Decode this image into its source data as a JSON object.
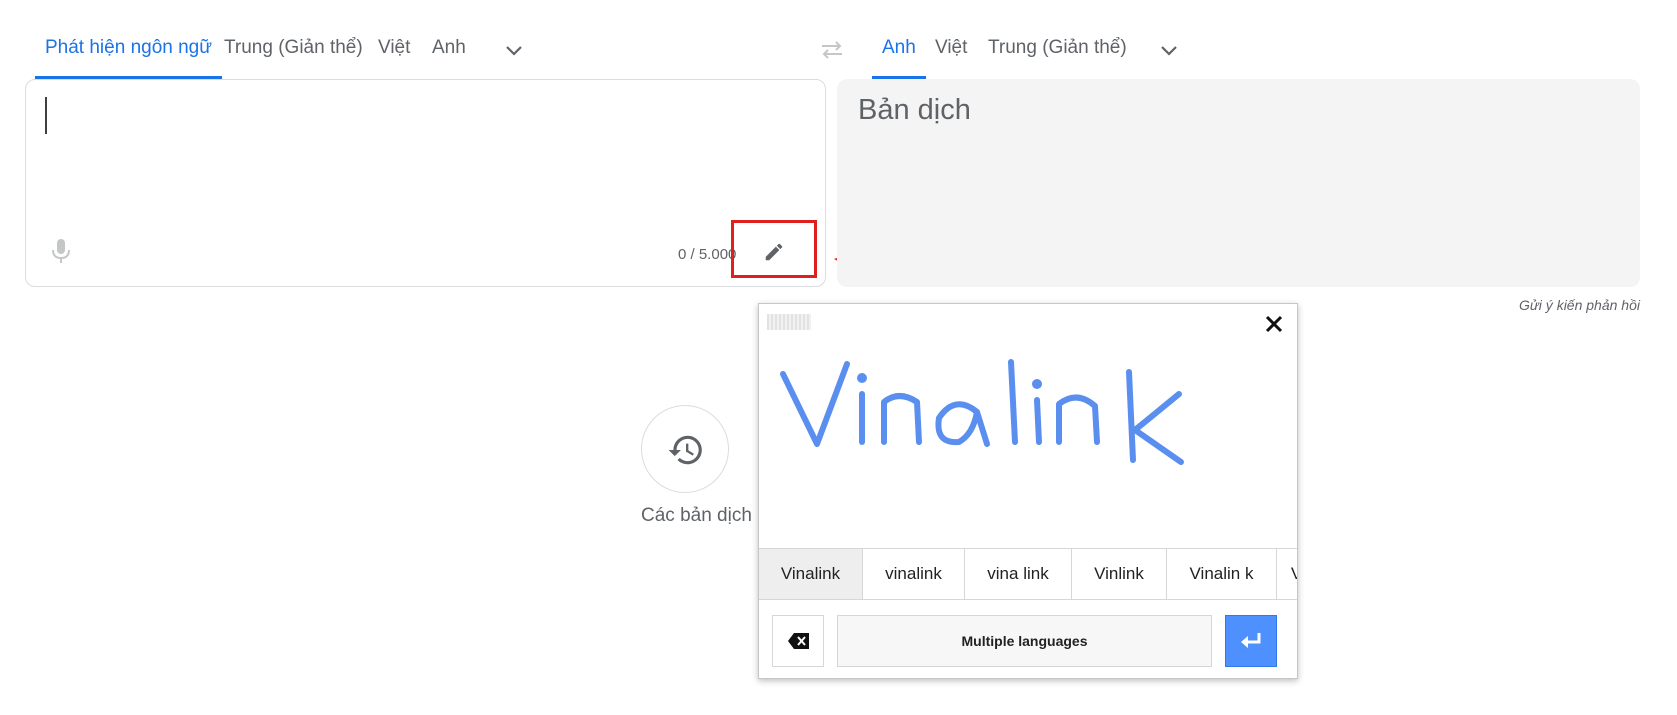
{
  "source_tabs": [
    {
      "label": "Phát hiện ngôn ngữ",
      "active": true
    },
    {
      "label": "Trung (Giản thể)",
      "active": false
    },
    {
      "label": "Việt",
      "active": false
    },
    {
      "label": "Anh",
      "active": false
    }
  ],
  "target_tabs": [
    {
      "label": "Anh",
      "active": true
    },
    {
      "label": "Việt",
      "active": false
    },
    {
      "label": "Trung (Giản thể)",
      "active": false
    }
  ],
  "source": {
    "value": "",
    "char_count": "0 / 5.000"
  },
  "target": {
    "placeholder": "Bản dịch"
  },
  "feedback_link": "Gửi ý kiến phản hồi",
  "history": {
    "label": "Các bản dịch đ"
  },
  "handwriting": {
    "ink_text": "Vinalink",
    "candidates": [
      "Vinalink",
      "vinalink",
      "vina link",
      "Vinlink",
      "Vinalin k",
      "V"
    ],
    "language_button": "Multiple languages"
  },
  "colors": {
    "accent": "#1a73e8",
    "annotation": "#e0201c",
    "ink": "#5a8ff0",
    "enter": "#4d90fe"
  },
  "icons": [
    "chevron-down-icon",
    "swap-languages-icon",
    "microphone-icon",
    "pencil-icon",
    "history-icon",
    "close-icon",
    "backspace-icon",
    "enter-icon"
  ]
}
